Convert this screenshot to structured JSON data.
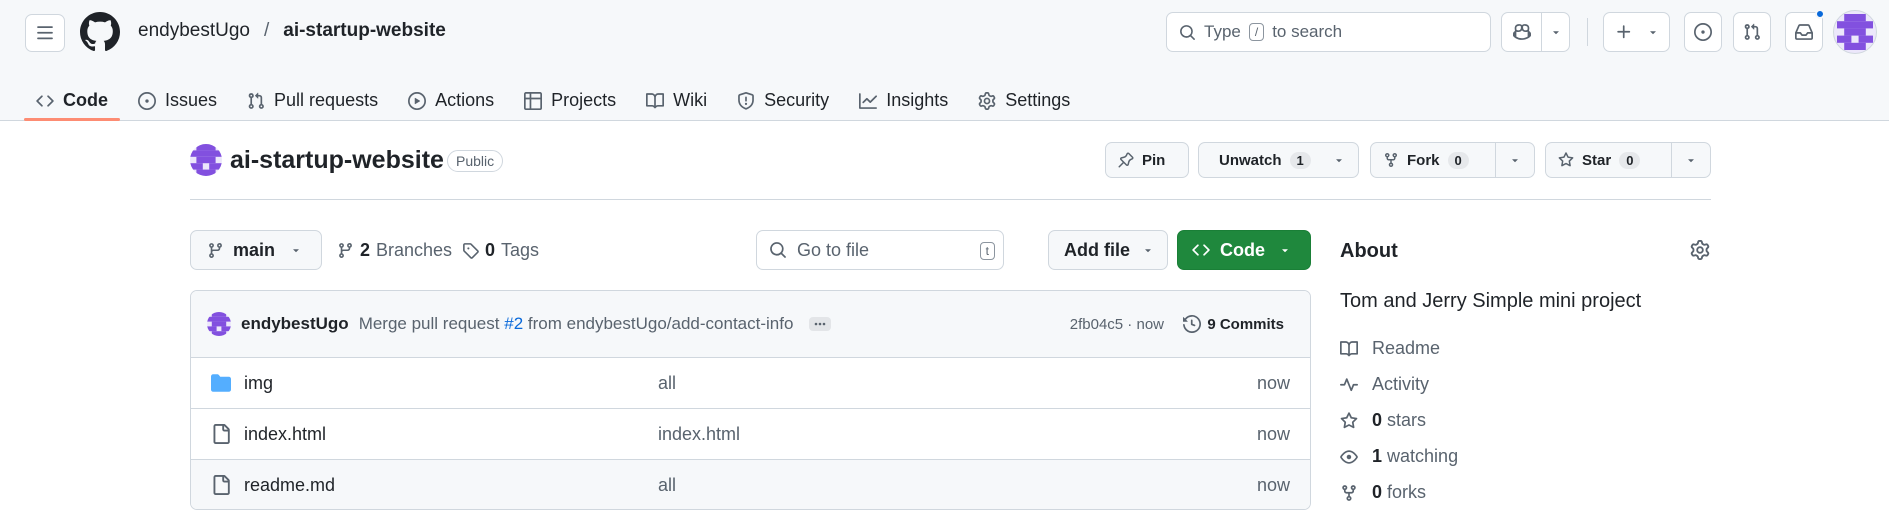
{
  "header": {
    "owner": "endybestUgo",
    "separator": "/",
    "repo": "ai-startup-website",
    "search_placeholder_pre": "Type",
    "search_key": "/",
    "search_placeholder_post": "to search"
  },
  "tabs": [
    {
      "label": "Code",
      "icon": "code-icon"
    },
    {
      "label": "Issues",
      "icon": "issue-icon"
    },
    {
      "label": "Pull requests",
      "icon": "pull-request-icon"
    },
    {
      "label": "Actions",
      "icon": "play-icon"
    },
    {
      "label": "Projects",
      "icon": "table-icon"
    },
    {
      "label": "Wiki",
      "icon": "book-icon"
    },
    {
      "label": "Security",
      "icon": "shield-icon"
    },
    {
      "label": "Insights",
      "icon": "graph-icon"
    },
    {
      "label": "Settings",
      "icon": "gear-icon"
    }
  ],
  "repo_head": {
    "name": "ai-startup-website",
    "visibility": "Public",
    "pin_label": "Pin",
    "watch_label": "Unwatch",
    "watch_count": "1",
    "fork_label": "Fork",
    "fork_count": "0",
    "star_label": "Star",
    "star_count": "0"
  },
  "toolbar": {
    "branch": "main",
    "branches_count": "2",
    "branches_label": "Branches",
    "tags_count": "0",
    "tags_label": "Tags",
    "goto_placeholder": "Go to file",
    "goto_key": "t",
    "add_file": "Add file",
    "code": "Code"
  },
  "commit": {
    "author": "endybestUgo",
    "message_pre": "Merge pull request",
    "pr_link": "#2",
    "message_post": "from endybestUgo/add-contact-info",
    "sha": "2fb04c5 · now",
    "count": "9 Commits"
  },
  "files": [
    {
      "name": "img",
      "type": "folder",
      "commit": "all",
      "age": "now"
    },
    {
      "name": "index.html",
      "type": "file",
      "commit": "index.html",
      "age": "now"
    },
    {
      "name": "readme.md",
      "type": "file",
      "commit": "all",
      "age": "now"
    }
  ],
  "about": {
    "title": "About",
    "description": "Tom and Jerry Simple mini project",
    "readme": "Readme",
    "activity": "Activity",
    "stars_count": "0",
    "stars_label": "stars",
    "watching_count": "1",
    "watching_label": "watching",
    "forks_count": "0",
    "forks_label": "forks"
  },
  "colors": {
    "accent_green": "#1f883d",
    "link_blue": "#0969da",
    "tab_underline": "#fd8c73",
    "folder_blue": "#54aeff"
  }
}
